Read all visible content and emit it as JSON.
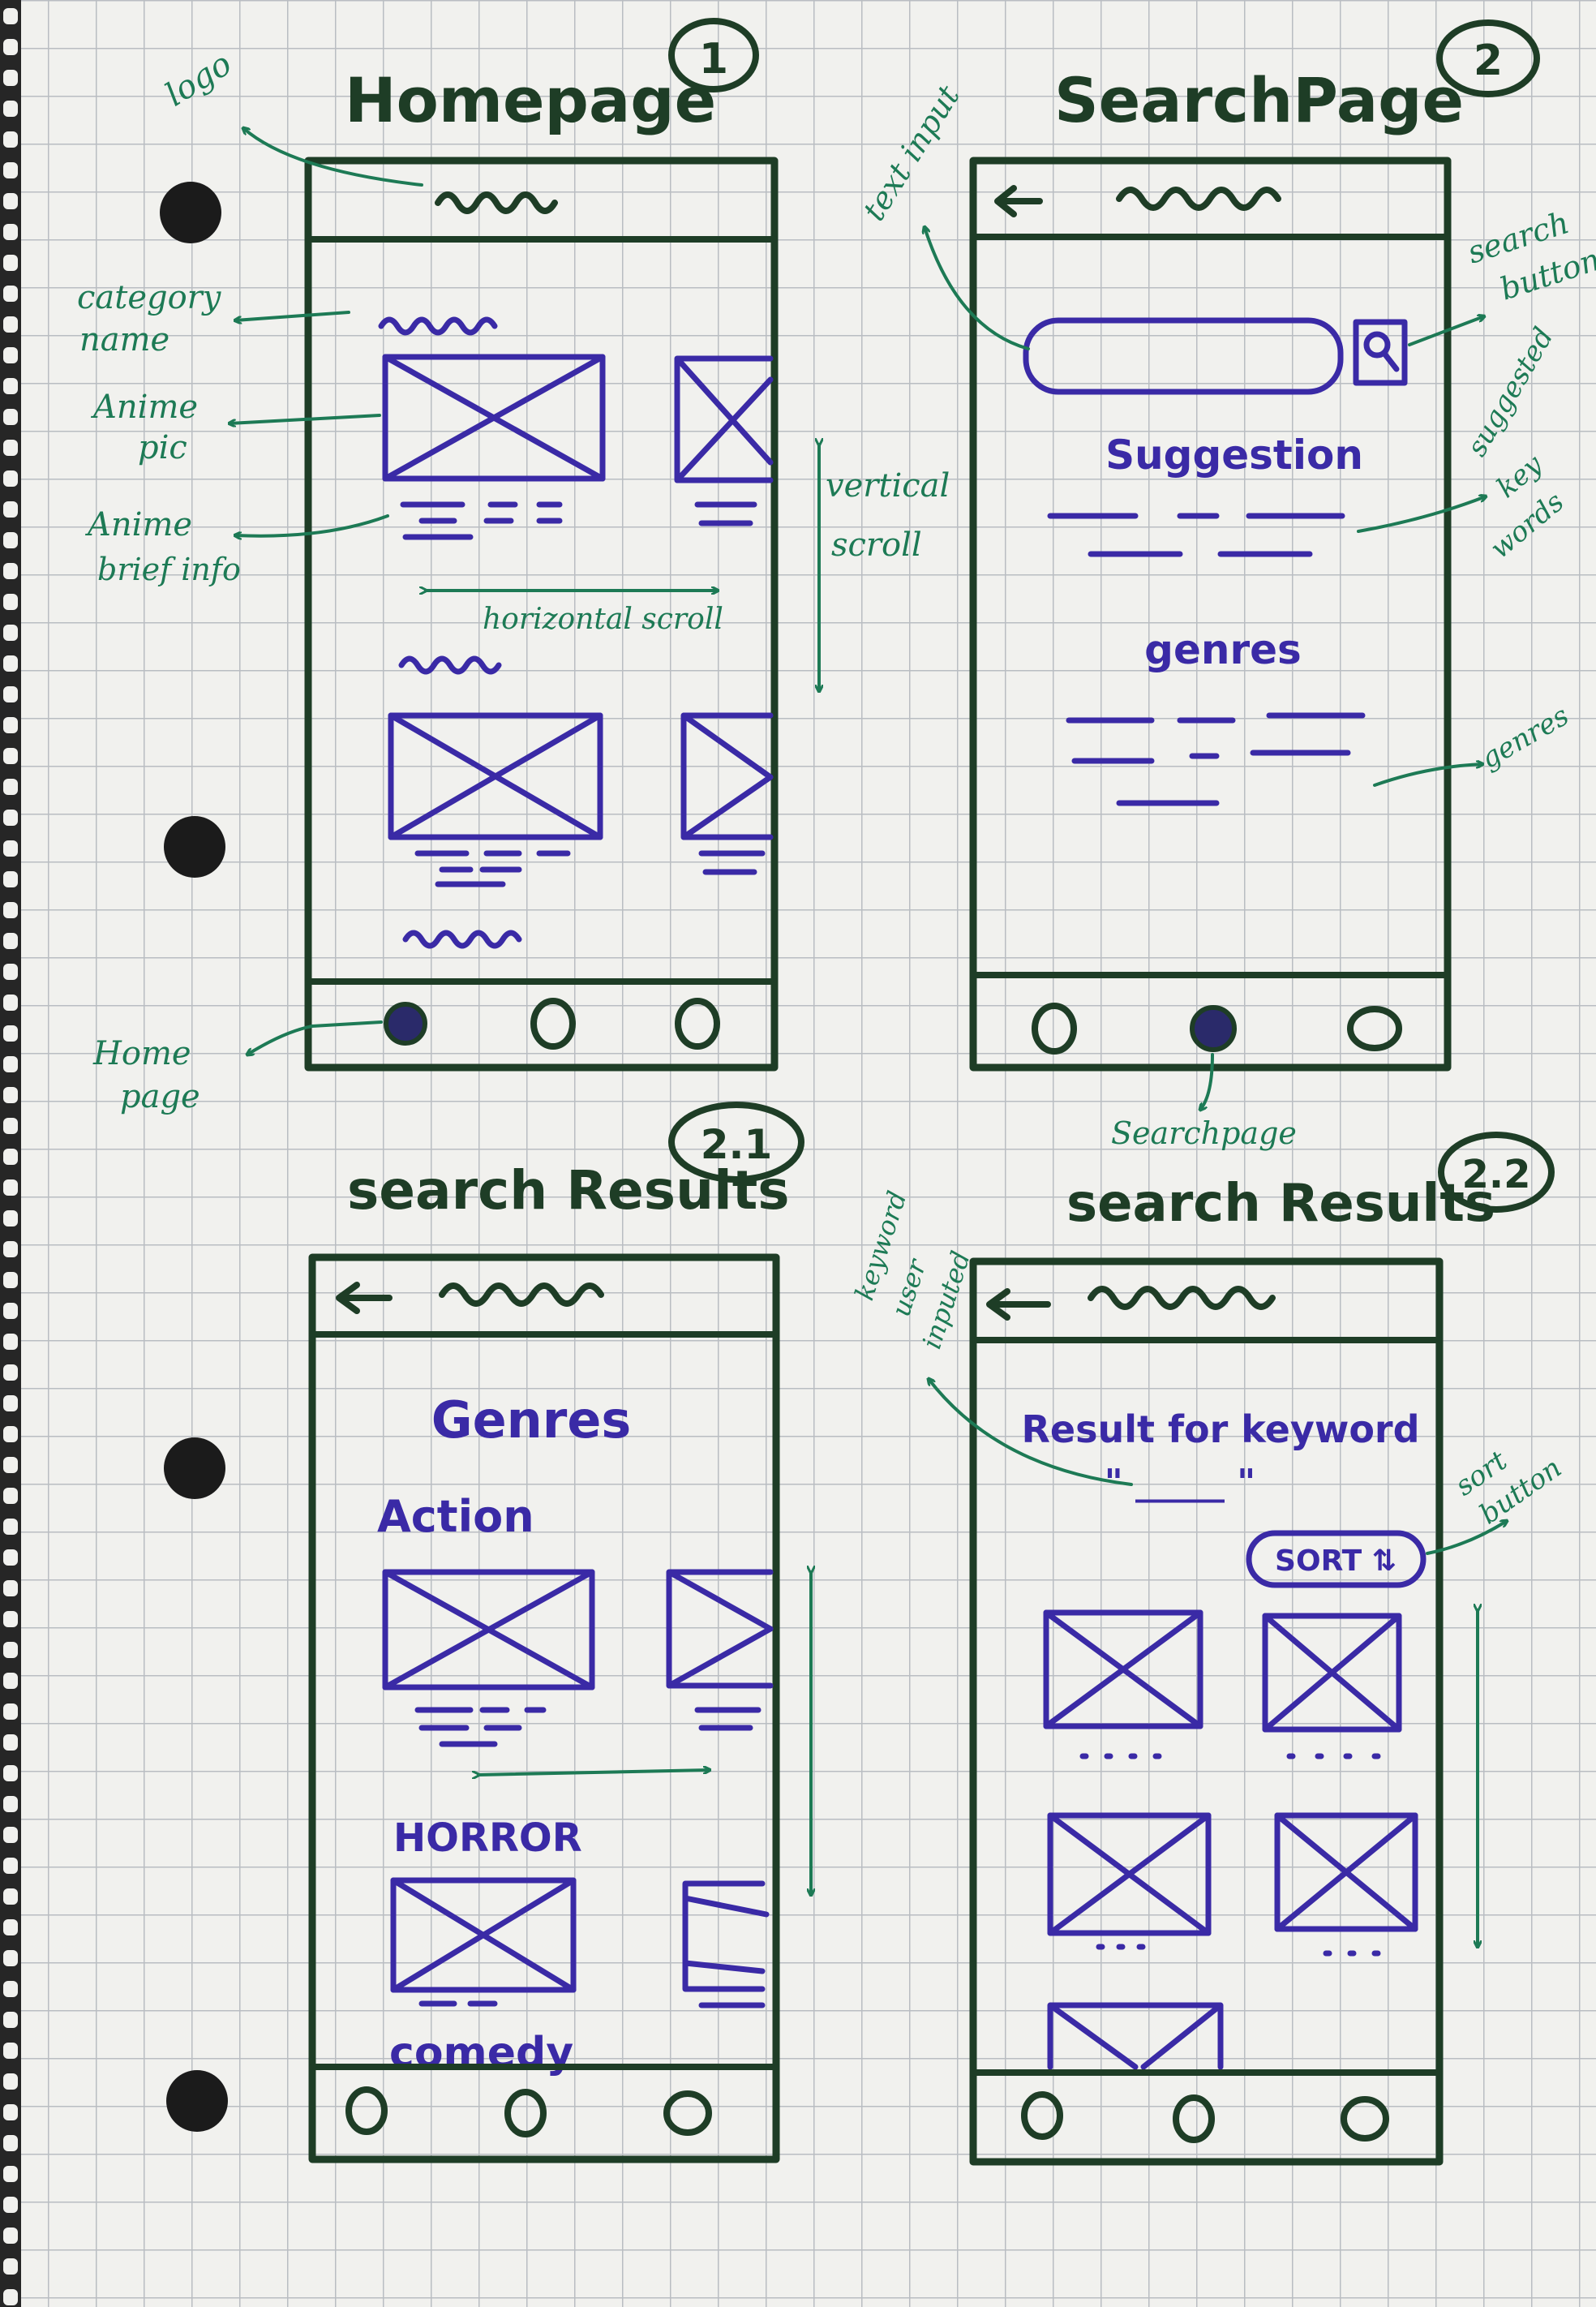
{
  "titles": {
    "homepage": "Homepage",
    "homepage_num": "1",
    "search_page": "SearchPage",
    "search_page_num": "2",
    "search_results_genres": "search Results",
    "search_results_genres_num": "2.1",
    "search_results_keyword": "search Results",
    "search_results_keyword_num": "2.2"
  },
  "notes": {
    "logo": "logo",
    "category_name": [
      "category",
      "name"
    ],
    "anime_pic": [
      "Anime",
      "pic"
    ],
    "anime_brief_info": [
      "Anime",
      "brief info"
    ],
    "horizontal_scroll": "horizontal scroll",
    "vertical_scroll": [
      "vertical",
      "scroll"
    ],
    "home_page": [
      "Home",
      "page"
    ],
    "text_input": "text input",
    "search_button": [
      "search",
      "button"
    ],
    "suggested_key_words": [
      "suggested",
      "key",
      "words"
    ],
    "genres": "genres",
    "searchpage": "Searchpage",
    "keyword_user_inputed": [
      "keyword",
      "user",
      "inputed"
    ],
    "sort_button": [
      "sort",
      "button"
    ]
  },
  "search_page": {
    "suggestion_heading": "Suggestion",
    "genres_heading": "genres"
  },
  "genres_results": {
    "heading": "Genres",
    "categories": [
      "Action",
      "HORROR",
      "comedy"
    ]
  },
  "keyword_results": {
    "heading": "Result for keyword",
    "keyword": "\" _____ \"",
    "sort_label": "SORT ⇅"
  },
  "colors": {
    "paper": "#f1f1ee",
    "grid": "#b9bdc2",
    "frame_ink": "#1e3d26",
    "content_ink": "#3a2aa6",
    "annotation_ink": "#1d7a55",
    "binding_hole": "#1b1b1b"
  }
}
